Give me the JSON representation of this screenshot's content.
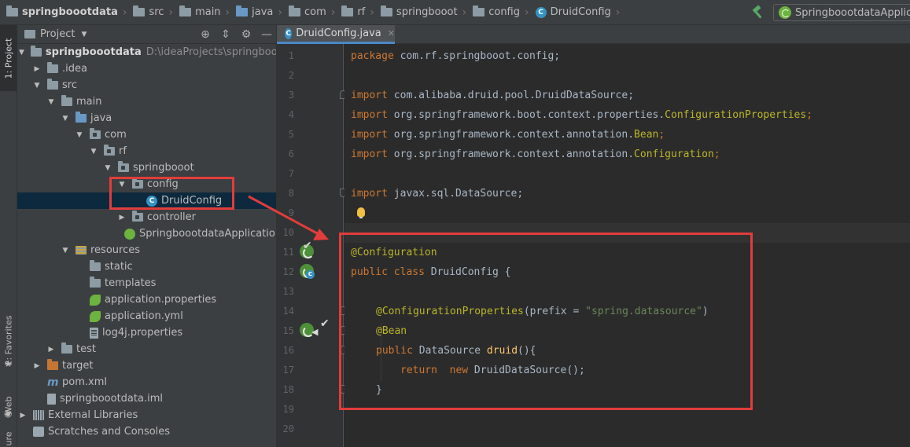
{
  "navbar": {
    "crumbs": [
      "springboootdata",
      "src",
      "main",
      "java",
      "com",
      "rf",
      "springbooot",
      "config",
      "DruidConfig"
    ],
    "run_config": "SpringboootdataApplication"
  },
  "tool_strip": {
    "project": "1: Project",
    "favorites": "2: Favorites",
    "web": "Web",
    "more": "ure"
  },
  "project_panel": {
    "title": "Project",
    "tree": [
      {
        "label": "springboootdata",
        "path": "D:\\ideaProjects\\springboootda"
      },
      {
        "label": ".idea"
      },
      {
        "label": "src"
      },
      {
        "label": "main"
      },
      {
        "label": "java"
      },
      {
        "label": "com"
      },
      {
        "label": "rf"
      },
      {
        "label": "springbooot"
      },
      {
        "label": "config"
      },
      {
        "label": "DruidConfig"
      },
      {
        "label": "controller"
      },
      {
        "label": "SpringboootdataApplication"
      },
      {
        "label": "resources"
      },
      {
        "label": "static"
      },
      {
        "label": "templates"
      },
      {
        "label": "application.properties"
      },
      {
        "label": "application.yml"
      },
      {
        "label": "log4j.properties"
      },
      {
        "label": "test"
      },
      {
        "label": "target"
      },
      {
        "label": "pom.xml"
      },
      {
        "label": "springboootdata.iml"
      },
      {
        "label": "External Libraries"
      },
      {
        "label": "Scratches and Consoles"
      }
    ]
  },
  "editor": {
    "tab": "DruidConfig.java",
    "line_numbers": [
      "1",
      "2",
      "3",
      "4",
      "5",
      "6",
      "7",
      "8",
      "9",
      "10",
      "11",
      "12",
      "13",
      "14",
      "15",
      "16",
      "17",
      "18",
      "19",
      "20"
    ],
    "code": {
      "l1_kw": "package",
      "l1_rest": " com.rf.springbooot.config;",
      "l3_kw": "import",
      "l3_rest": " com.alibaba.druid.pool.DruidDataSource;",
      "l4_kw": "import",
      "l4_rest": " org.springframework.boot.context.properties.",
      "l4_cls": "ConfigurationProperties",
      "l4_end": ";",
      "l5_kw": "import",
      "l5_rest": " org.springframework.context.annotation.",
      "l5_cls": "Bean",
      "l5_end": ";",
      "l6_kw": "import",
      "l6_rest": " org.springframework.context.annotation.",
      "l6_cls": "Configuration",
      "l6_end": ";",
      "l8_kw": "import",
      "l8_rest": " javax.sql.DataSource;",
      "l11_ann": "@Configuration",
      "l12_kw": "public class",
      "l12_rest": " DruidConfig {",
      "l14_ann": "@ConfigurationProperties",
      "l14_a": "(prefix = ",
      "l14_str": "\"spring.datasource\"",
      "l14_b": ")",
      "l15_ann": "@Bean",
      "l16_kw": "public",
      "l16_rest": " DataSource ",
      "l16_fn": "druid",
      "l16_end": "(){",
      "l17_kw": "return  new",
      "l17_rest": " DruidDataSource();",
      "l18_rest": "}"
    }
  },
  "colors": {
    "highlight_red": "#e23c3c",
    "keyword": "#cc7832",
    "annotation": "#bbb529",
    "string": "#6a8759",
    "selection": "#0d293e"
  }
}
